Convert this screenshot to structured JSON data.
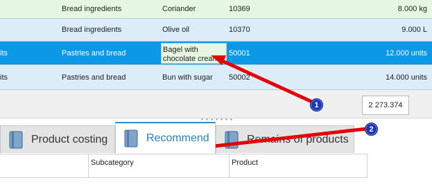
{
  "grid": {
    "rows": [
      {
        "unit_partial": "",
        "category": "Bread ingredients",
        "product": "Coriander",
        "code": "10369",
        "qty": "8.000 kg"
      },
      {
        "unit_partial": "",
        "category": "Bread ingredients",
        "product": "Olive oil",
        "code": "10370",
        "qty": "9.000 L"
      },
      {
        "unit_partial": "its",
        "category": "Pastries and bread",
        "product": "Bagel with chocolate cream",
        "code": "50001",
        "qty": "12.000 units"
      },
      {
        "unit_partial": "its",
        "category": "Pastries and bread",
        "product": "Bun with sugar",
        "code": "50002",
        "qty": "14.000 units"
      }
    ],
    "total": "2 273.374"
  },
  "tabs": [
    {
      "label": "Product costing"
    },
    {
      "label": "Recommend"
    },
    {
      "label": "Remains of products"
    }
  ],
  "subgrid": {
    "headers": [
      "",
      "Subcategory",
      "Product"
    ]
  },
  "annotations": {
    "badge1": "1",
    "badge2": "2"
  },
  "colors": {
    "selected_row": "#0c98e7",
    "even_row": "#dcedf9",
    "odd_row": "#e6f7e1",
    "arrow": "#e30000",
    "badge": "#1838b8",
    "active_tab_text": "#2c7fc0"
  }
}
